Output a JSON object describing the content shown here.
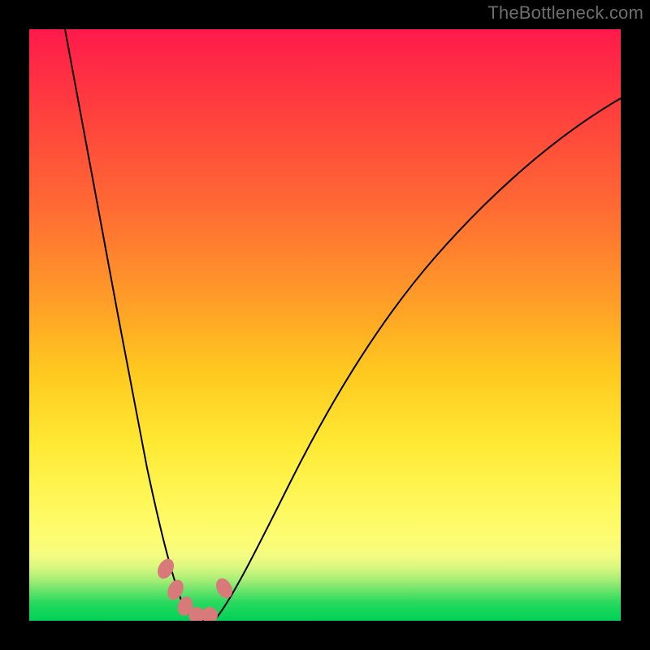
{
  "watermark": "TheBottleneck.com",
  "chart_data": {
    "type": "line",
    "title": "",
    "xlabel": "",
    "ylabel": "",
    "x_range": [
      0,
      100
    ],
    "y_range": [
      0,
      100
    ],
    "y_orientation": "top_is_high_bottleneck",
    "description": "V-shaped bottleneck curve; vertical position maps to severity gradient (red=high at top, green=low at bottom). Minimum near x≈27.",
    "series": [
      {
        "name": "bottleneck_curve",
        "x": [
          6,
          10,
          14,
          18,
          21,
          23,
          25,
          27,
          29,
          31,
          33,
          36,
          40,
          45,
          52,
          60,
          70,
          82,
          95,
          100
        ],
        "y": [
          100,
          80,
          60,
          40,
          25,
          14,
          6,
          1,
          1,
          5,
          12,
          22,
          35,
          47,
          58,
          67,
          75,
          82,
          87,
          89
        ]
      }
    ],
    "markers": [
      {
        "x": 22.5,
        "y": 9
      },
      {
        "x": 24.0,
        "y": 5
      },
      {
        "x": 25.5,
        "y": 2
      },
      {
        "x": 27.5,
        "y": 0.5
      },
      {
        "x": 30.0,
        "y": 0.5
      },
      {
        "x": 32.5,
        "y": 6
      }
    ],
    "gradient_stops": [
      {
        "pos": 0,
        "color": "#ff1a4b"
      },
      {
        "pos": 50,
        "color": "#ffc91f"
      },
      {
        "pos": 85,
        "color": "#fff85a"
      },
      {
        "pos": 100,
        "color": "#00d157"
      }
    ]
  }
}
